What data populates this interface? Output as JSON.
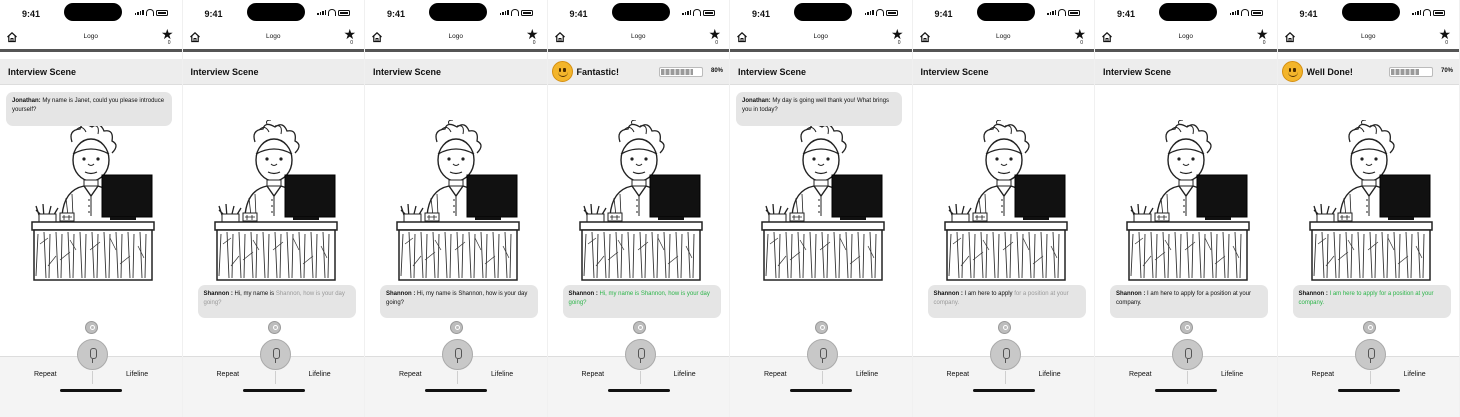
{
  "status": {
    "time": "9:41"
  },
  "appbar": {
    "logo": "Logo",
    "favorites_count": "0"
  },
  "scene_title": "Interview Scene",
  "bottom": {
    "repeat": "Repeat",
    "lifeline": "Lifeline"
  },
  "colors": {
    "success_green": "#2db54a",
    "emoji_yellow": "#f3b52b",
    "pending_gray": "#9a9a9a"
  },
  "screens": [
    {
      "header": "title",
      "bubble_position": "top",
      "speaker": "Jonathan:",
      "segments": [
        {
          "text": " My name is Janet, could you please introduce yourself?",
          "style": "normal"
        }
      ]
    },
    {
      "header": "title",
      "bubble_position": "bottom",
      "speaker": "Shannon : ",
      "segments": [
        {
          "text": "Hi, my name is ",
          "style": "normal"
        },
        {
          "text": "Shannon, how is your day going?",
          "style": "gray"
        }
      ]
    },
    {
      "header": "title",
      "bubble_position": "bottom",
      "speaker": "Shannon : ",
      "segments": [
        {
          "text": "Hi, my name is Shannon, how is your day going?",
          "style": "normal"
        }
      ]
    },
    {
      "header": "feedback",
      "feedback_text": "Fantastic!",
      "progress_percent": 80,
      "progress_label": "80%",
      "bubble_position": "bottom",
      "speaker": "Shannon : ",
      "segments": [
        {
          "text": "Hi, my name is Shannon, how is your day going?",
          "style": "green"
        }
      ]
    },
    {
      "header": "title",
      "bubble_position": "top",
      "speaker": "Jonathan:",
      "segments": [
        {
          "text": " My day is going well thank you! What brings you in today?",
          "style": "normal"
        }
      ]
    },
    {
      "header": "title",
      "bubble_position": "bottom",
      "speaker": "Shannon : ",
      "segments": [
        {
          "text": "I am here to apply ",
          "style": "normal"
        },
        {
          "text": "for a position at your company.",
          "style": "gray"
        }
      ]
    },
    {
      "header": "title",
      "bubble_position": "bottom",
      "speaker": "Shannon : ",
      "segments": [
        {
          "text": "I am here to apply for a position at your company.",
          "style": "normal"
        }
      ]
    },
    {
      "header": "feedback",
      "feedback_text": "Well Done!",
      "progress_percent": 70,
      "progress_label": "70%",
      "bubble_position": "bottom",
      "speaker": "Shannon : ",
      "segments": [
        {
          "text": "I am here to apply for a position at your company.",
          "style": "green"
        }
      ]
    }
  ]
}
